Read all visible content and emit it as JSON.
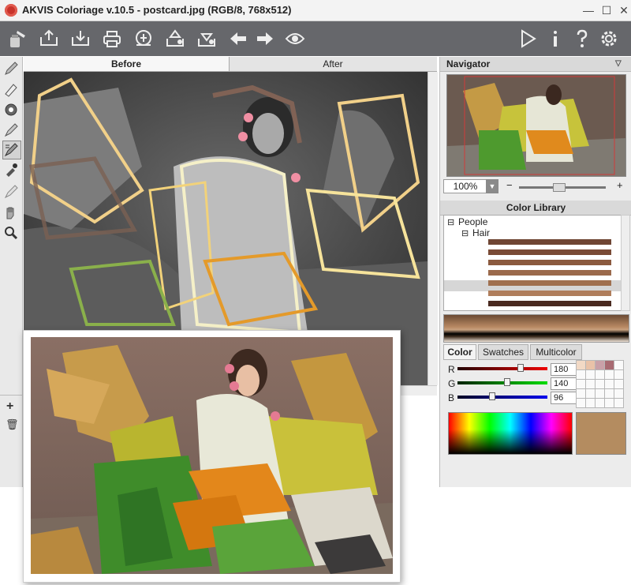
{
  "window": {
    "title": "AKVIS Coloriage v.10.5 - postcard.jpg (RGB/8, 768x512)",
    "minimize": "—",
    "maximize": "☐",
    "close": "✕"
  },
  "toolbar": {
    "left_icons": [
      "logo-brush-icon",
      "open-icon",
      "save-icon",
      "print-icon",
      "share-icon",
      "export-icon",
      "import-icon",
      "undo-icon",
      "redo-icon",
      "preview-eye-icon"
    ],
    "right_icons": [
      "run-icon",
      "info-icon",
      "help-icon",
      "settings-icon"
    ]
  },
  "tools": [
    "pencil-icon",
    "eraser-icon",
    "keep-color-icon",
    "brush-icon",
    "color-range-icon",
    "eyedropper-icon",
    "smudge-icon",
    "hand-icon",
    "zoom-icon"
  ],
  "tools_bottom": {
    "add": "+",
    "delete": "🗑"
  },
  "tabs": {
    "before": "Before",
    "after": "After"
  },
  "navigator": {
    "title": "Navigator",
    "zoom": "100%",
    "zoom_minus": "−",
    "zoom_plus": "+",
    "zoom_level": 0.45
  },
  "color_library": {
    "title": "Color Library",
    "root": "People",
    "child": "Hair",
    "swatches": [
      "#6f4634",
      "#7a4b36",
      "#8b5a3f",
      "#9b6a4c",
      "#a0704f",
      "#b07e5c",
      "#4a2a20",
      "#302020"
    ]
  },
  "color_tabs": [
    "Color",
    "Swatches",
    "Multicolor"
  ],
  "rgb": {
    "r_label": "R",
    "r_value": "180",
    "g_label": "G",
    "g_value": "140",
    "b_label": "B",
    "b_value": "96",
    "current_color": "#b48c60"
  },
  "palette_swatches": [
    "#f2d9c5",
    "#e9c2a8",
    "#c9a0a8",
    "#a86a72",
    "#fafafa",
    "#fafafa",
    "#fafafa",
    "#fafafa",
    "#fafafa",
    "#fafafa",
    "#fafafa",
    "#fafafa",
    "#fafafa",
    "#fafafa",
    "#fafafa",
    "#fafafa",
    "#fafafa",
    "#fafafa",
    "#fafafa",
    "#fafafa",
    "#fafafa",
    "#fafafa",
    "#fafafa",
    "#fafafa",
    "#fafafa"
  ]
}
